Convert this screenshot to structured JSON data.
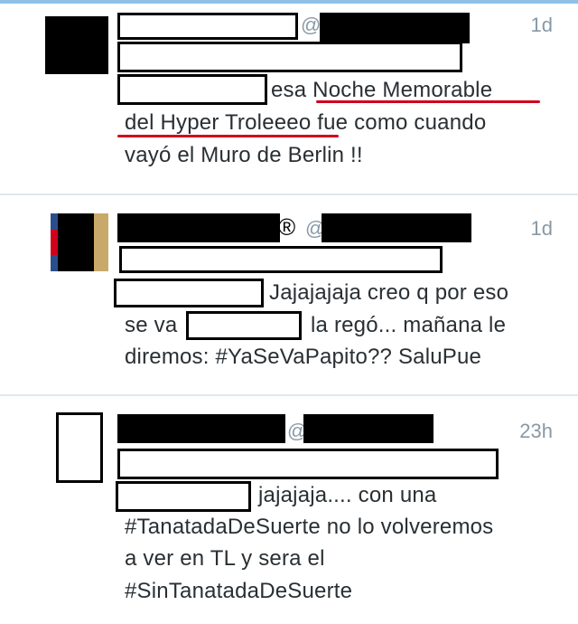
{
  "tweets": [
    {
      "timestamp": "1d",
      "lines": [
        "esa Noche Memorable",
        "del Hyper Troleeeo fue como cuando",
        "vayó el Muro de Berlin !!"
      ],
      "highlight": {
        "part1": "Noche Memorable",
        "part2": "del Hyper Troleeeo"
      },
      "accent_color": "#d0021b"
    },
    {
      "timestamp": "1d",
      "verified_mark": "®",
      "lines": [
        "Jajajajaja creo q por eso",
        "se va",
        "la regó... mañana le",
        "diremos: #YaSeVaPapito?? SaluPue"
      ]
    },
    {
      "timestamp": "23h",
      "lines": [
        "jajajaja.... con una",
        "#TanatadaDeSuerte no lo volveremos",
        "a ver en TL y sera el",
        "#SinTanatadaDeSuerte"
      ]
    }
  ],
  "at_symbol": "@",
  "colors": {
    "meta": "#8899a6",
    "text": "#292f33",
    "divider": "#e1e8ed",
    "underline": "#d0021b"
  }
}
